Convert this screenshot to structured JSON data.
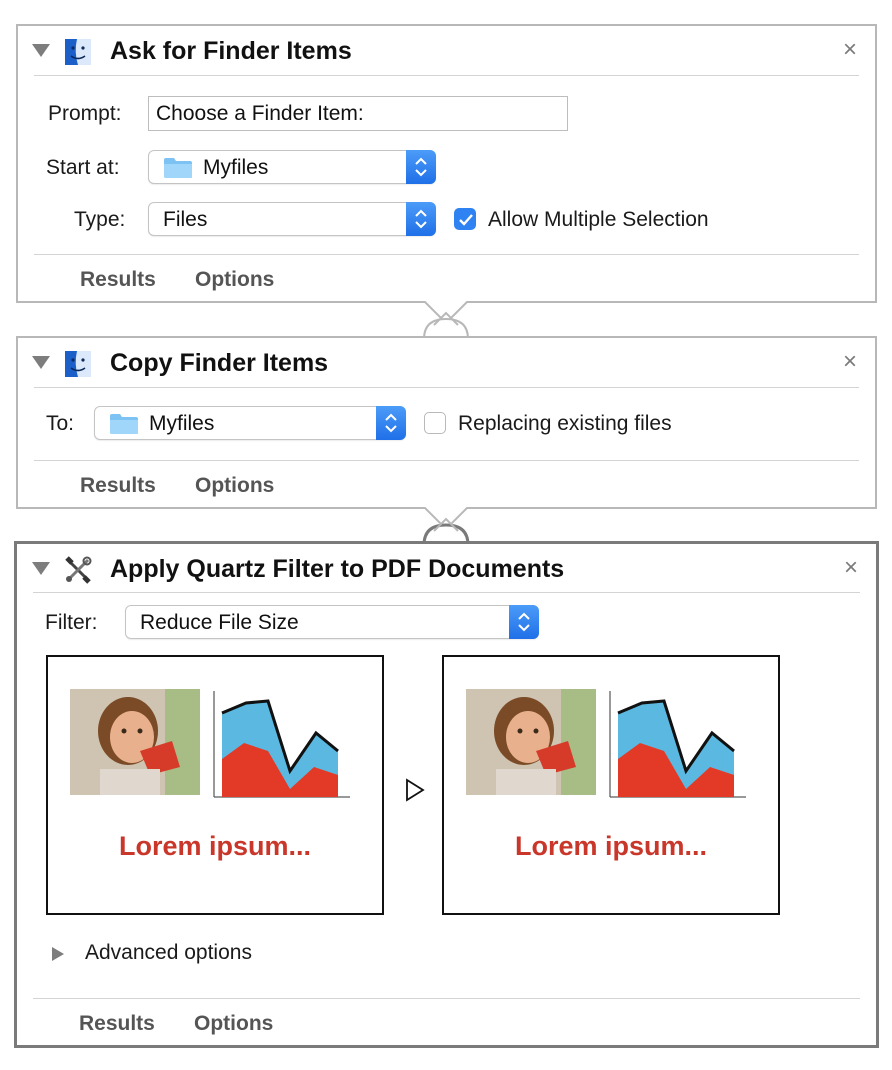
{
  "actions": [
    {
      "title": "Ask for Finder Items",
      "icon": "finder-icon",
      "prompt_label": "Prompt:",
      "prompt_value": "Choose a Finder Item:",
      "start_label": "Start at:",
      "start_value": "Myfiles",
      "type_label": "Type:",
      "type_value": "Files",
      "allow_multiple_label": "Allow Multiple Selection",
      "allow_multiple_checked": true,
      "tabs": [
        "Results",
        "Options"
      ]
    },
    {
      "title": "Copy Finder Items",
      "icon": "finder-icon",
      "to_label": "To:",
      "to_value": "Myfiles",
      "replacing_label": "Replacing existing files",
      "replacing_checked": false,
      "tabs": [
        "Results",
        "Options"
      ]
    },
    {
      "title": "Apply Quartz Filter to PDF Documents",
      "icon": "automator-tools-icon",
      "filter_label": "Filter:",
      "filter_value": "Reduce File Size",
      "preview_text_before": "Lorem ipsum...",
      "preview_text_after": "Lorem ipsum...",
      "advanced_label": "Advanced options",
      "tabs": [
        "Results",
        "Options"
      ]
    }
  ],
  "close_glyph": "×",
  "colors": {
    "accent": "#2f82f2",
    "border": "#b8b8b8",
    "selected_border": "#7a7a7a",
    "preview_text": "#c9362a"
  }
}
